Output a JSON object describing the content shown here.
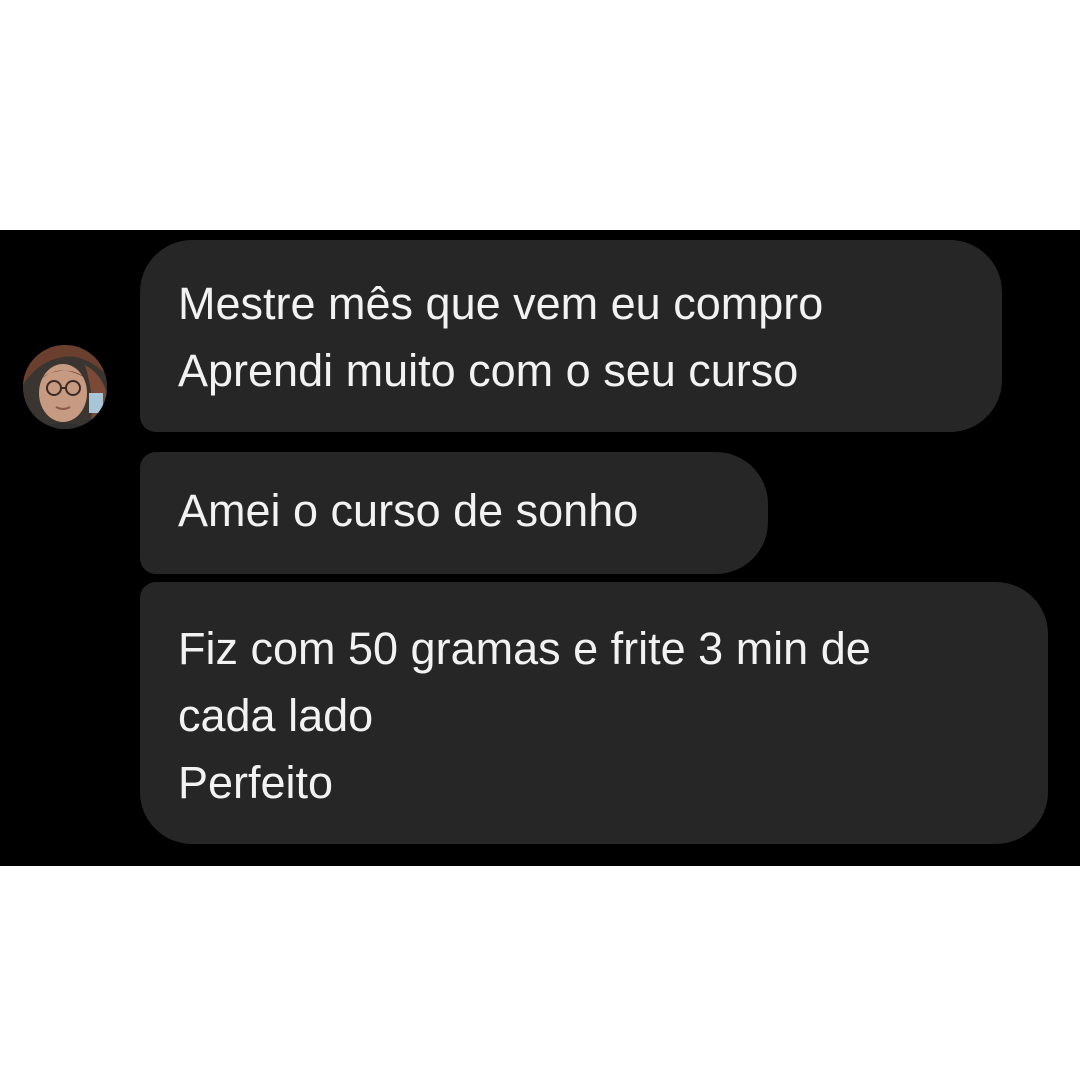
{
  "conversation": {
    "contact": {
      "avatar_icon": "contact-avatar"
    },
    "messages": [
      {
        "lines": [
          "Mestre mês que vem eu compro",
          "Aprendi muito com o seu curso"
        ]
      },
      {
        "lines": [
          "Amei o curso de sonho"
        ]
      },
      {
        "lines": [
          "Fiz com 50 gramas e frite 3 min de",
          "cada lado",
          "Perfeito"
        ]
      }
    ]
  },
  "colors": {
    "page_background": "#ffffff",
    "chat_background": "#000000",
    "bubble_background": "#262626",
    "text": "#f2f2f2"
  }
}
